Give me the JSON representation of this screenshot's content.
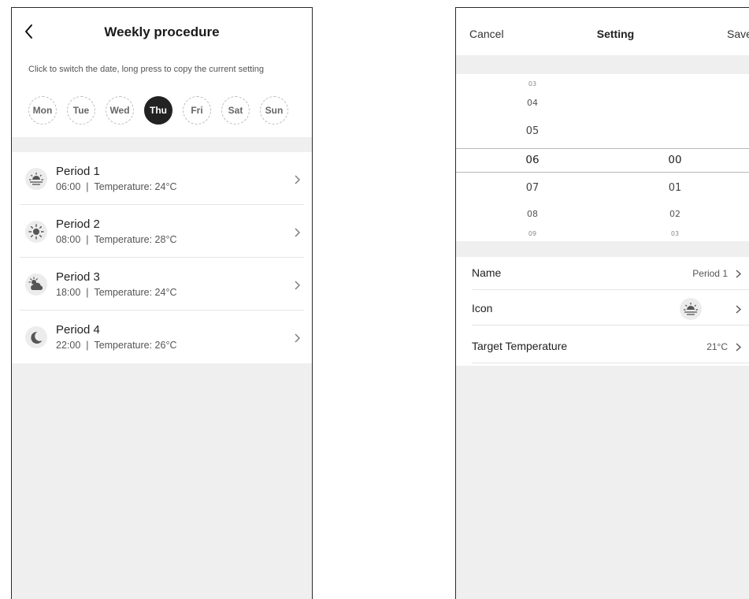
{
  "weekly": {
    "title": "Weekly procedure",
    "hint": "Click to switch the date, long press to copy the current setting",
    "days": [
      {
        "label": "Mon",
        "active": false
      },
      {
        "label": "Tue",
        "active": false
      },
      {
        "label": "Wed",
        "active": false
      },
      {
        "label": "Thu",
        "active": true
      },
      {
        "label": "Fri",
        "active": false
      },
      {
        "label": "Sat",
        "active": false
      },
      {
        "label": "Sun",
        "active": false
      }
    ],
    "periods": [
      {
        "name": "Period 1",
        "time": "06:00",
        "temperature": "Temperature: 24°C",
        "icon": "sunrise-icon"
      },
      {
        "name": "Period 2",
        "time": "08:00",
        "temperature": "Temperature: 28°C",
        "icon": "sun-icon"
      },
      {
        "name": "Period 3",
        "time": "18:00",
        "temperature": "Temperature: 24°C",
        "icon": "sun-cloud-icon"
      },
      {
        "name": "Period 4",
        "time": "22:00",
        "temperature": "Temperature: 26°C",
        "icon": "moon-icon"
      }
    ],
    "separator": "|"
  },
  "setting": {
    "cancel": "Cancel",
    "title": "Setting",
    "save": "Save",
    "hours": [
      "03",
      "04",
      "05",
      "06",
      "07",
      "08",
      "09"
    ],
    "minutes": [
      "00",
      "01",
      "02",
      "03"
    ],
    "selected_hour": "06",
    "selected_minute": "00",
    "rows": {
      "name_label": "Name",
      "name_value": "Period 1",
      "icon_label": "Icon",
      "icon_value": "sunrise-icon",
      "temp_label": "Target Temperature",
      "temp_value": "21°C"
    }
  },
  "colors": {
    "active_day": "#222222",
    "background": "#efefef",
    "card": "#ffffff"
  }
}
